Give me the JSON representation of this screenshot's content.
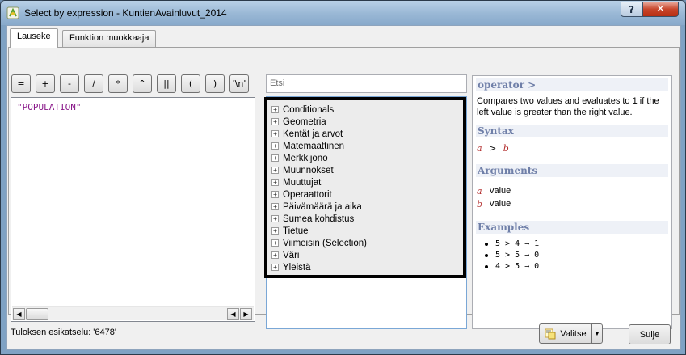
{
  "window": {
    "title": "Select by expression - KuntienAvainluvut_2014",
    "help_button": "?",
    "close_button": "✕"
  },
  "tabs": [
    {
      "label": "Lauseke"
    },
    {
      "label": "Funktion muokkaaja"
    }
  ],
  "operators": [
    "=",
    "+",
    "-",
    "/",
    "*",
    "^",
    "||",
    "(",
    ")",
    "'\\n'"
  ],
  "editor": {
    "expression": "\"POPULATION\""
  },
  "preview": {
    "text": "Tuloksen esikatselu:  '6478'"
  },
  "search": {
    "placeholder": "Etsi"
  },
  "function_tree": [
    "Conditionals",
    "Geometria",
    "Kentät ja arvot",
    "Matemaattinen",
    "Merkkijono",
    "Muunnokset",
    "Muuttujat",
    "Operaattorit",
    "Päivämäärä ja aika",
    "Sumea kohdistus",
    "Tietue",
    "Viimeisin (Selection)",
    "Väri",
    "Yleistä"
  ],
  "help": {
    "title": "operator >",
    "description": "Compares two values and evaluates to 1 if the left value is greater than the right value.",
    "syntax_heading": "Syntax",
    "syntax": {
      "a": "a",
      "op": ">",
      "b": "b"
    },
    "arguments_heading": "Arguments",
    "arguments": [
      {
        "name": "a",
        "desc": "value"
      },
      {
        "name": "b",
        "desc": "value"
      }
    ],
    "examples_heading": "Examples",
    "examples": [
      "5 > 4 → 1",
      "5 > 5 → 0",
      "4 > 5 → 0"
    ]
  },
  "buttons": {
    "select": "Valitse",
    "close": "Sulje"
  }
}
